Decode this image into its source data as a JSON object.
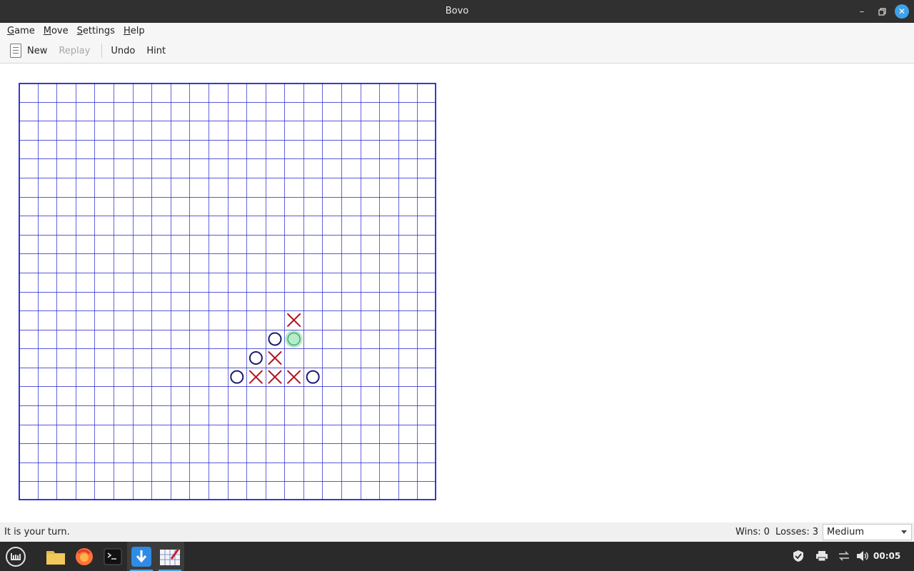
{
  "window": {
    "title": "Bovo",
    "controls": [
      "minimize",
      "maximize",
      "close"
    ]
  },
  "menu": {
    "items": [
      {
        "label": "Game",
        "accel": "G",
        "rest": "ame"
      },
      {
        "label": "Move",
        "accel": "M",
        "rest": "ove"
      },
      {
        "label": "Settings",
        "accel": "S",
        "rest": "ettings"
      },
      {
        "label": "Help",
        "accel": "H",
        "rest": "elp"
      }
    ]
  },
  "toolbar": {
    "new_label": "New",
    "replay_label": "Replay",
    "undo_label": "Undo",
    "hint_label": "Hint"
  },
  "board": {
    "columns": 22,
    "rows": 22,
    "grid_color": "#2222cc",
    "x_color": "#b0141e",
    "o_color": "#1a1a6e",
    "hint_color": "#7fd9a0",
    "marks": [
      {
        "col": 14,
        "row": 12,
        "mark": "X"
      },
      {
        "col": 13,
        "row": 13,
        "mark": "O"
      },
      {
        "col": 14,
        "row": 13,
        "mark": "O",
        "hint": true
      },
      {
        "col": 12,
        "row": 14,
        "mark": "O"
      },
      {
        "col": 13,
        "row": 14,
        "mark": "X"
      },
      {
        "col": 11,
        "row": 15,
        "mark": "O"
      },
      {
        "col": 12,
        "row": 15,
        "mark": "X"
      },
      {
        "col": 13,
        "row": 15,
        "mark": "X"
      },
      {
        "col": 14,
        "row": 15,
        "mark": "X"
      },
      {
        "col": 15,
        "row": 15,
        "mark": "O"
      }
    ]
  },
  "status": {
    "message": "It is your turn.",
    "wins_label": "Wins:",
    "wins": "0",
    "losses_label": "Losses:",
    "losses": "3",
    "difficulty": "Medium"
  },
  "taskbar": {
    "apps": [
      "menu-icon",
      "files-icon",
      "firefox-icon",
      "terminal-icon",
      "update-manager-icon",
      "bovo-icon"
    ],
    "tray": [
      "shield-icon",
      "printer-icon",
      "network-icon",
      "volume-icon"
    ],
    "clock": "00:05"
  }
}
